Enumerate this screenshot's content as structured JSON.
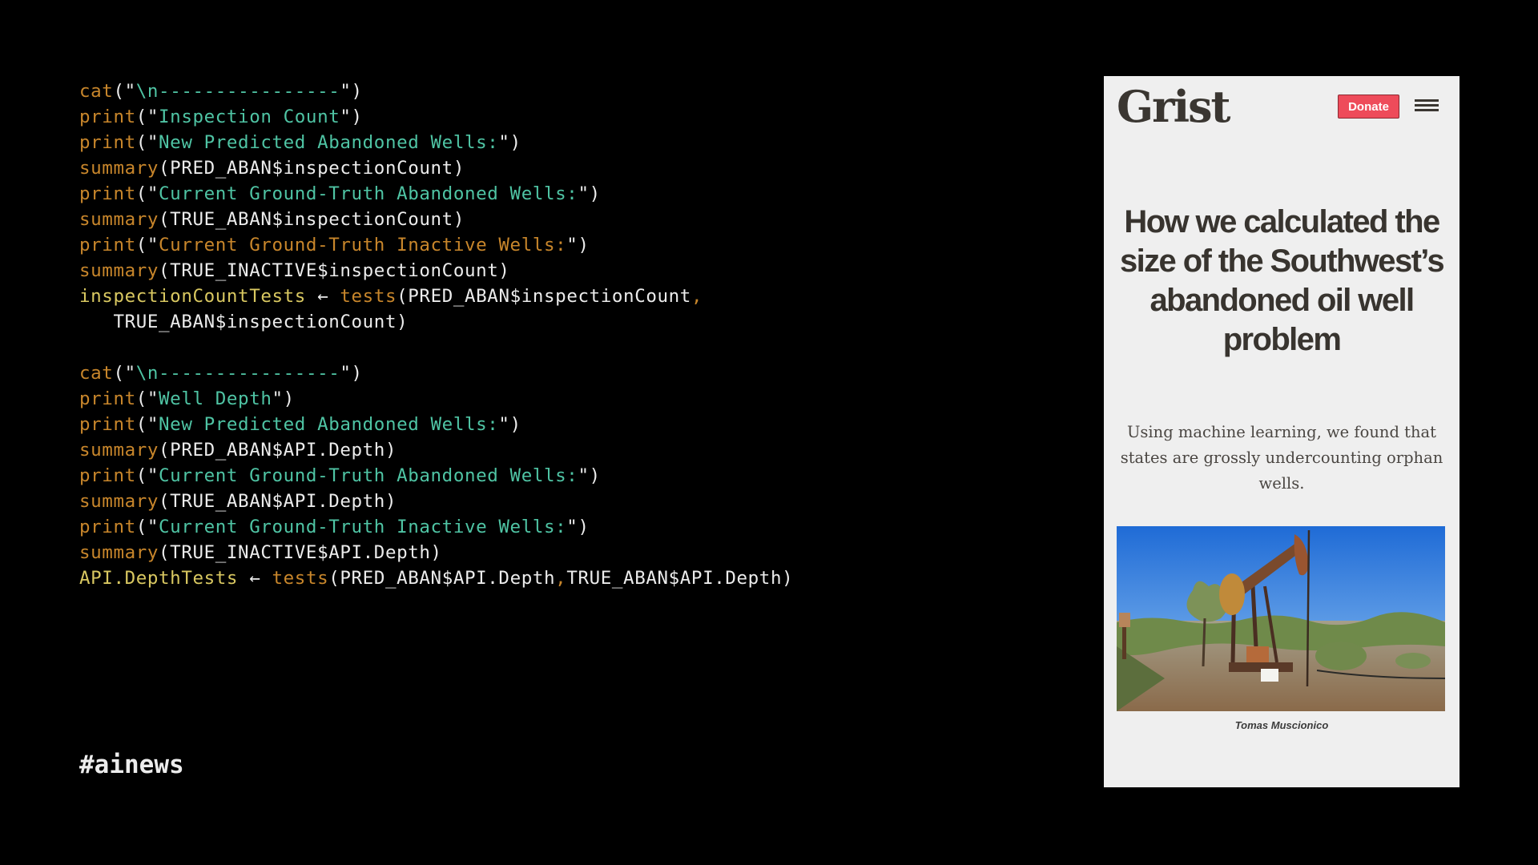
{
  "code": {
    "lines": [
      [
        {
          "t": "cat",
          "c": "fn"
        },
        {
          "t": "(\"",
          "c": "pl"
        },
        {
          "t": "\\n----------------",
          "c": "str"
        },
        {
          "t": "\")",
          "c": "pl"
        }
      ],
      [
        {
          "t": "print",
          "c": "fn"
        },
        {
          "t": "(\"",
          "c": "pl"
        },
        {
          "t": "Inspection Count",
          "c": "str"
        },
        {
          "t": "\")",
          "c": "pl"
        }
      ],
      [
        {
          "t": "print",
          "c": "fn"
        },
        {
          "t": "(\"",
          "c": "pl"
        },
        {
          "t": "New Predicted Abandoned Wells:",
          "c": "str"
        },
        {
          "t": "\")",
          "c": "pl"
        }
      ],
      [
        {
          "t": "summary",
          "c": "fn"
        },
        {
          "t": "(PRED_ABAN$inspectionCount)",
          "c": "pl"
        }
      ],
      [
        {
          "t": "print",
          "c": "fn"
        },
        {
          "t": "(\"",
          "c": "pl"
        },
        {
          "t": "Current Ground-Truth Abandoned Wells:",
          "c": "str"
        },
        {
          "t": "\")",
          "c": "pl"
        }
      ],
      [
        {
          "t": "summary",
          "c": "fn"
        },
        {
          "t": "(TRUE_ABAN$inspectionCount)",
          "c": "pl"
        }
      ],
      [
        {
          "t": "print",
          "c": "fn"
        },
        {
          "t": "(\"",
          "c": "pl"
        },
        {
          "t": "Current Ground-Truth Inactive Wells:",
          "c": "ostr"
        },
        {
          "t": "\")",
          "c": "pl"
        }
      ],
      [
        {
          "t": "summary",
          "c": "fn"
        },
        {
          "t": "(TRUE_INACTIVE$inspectionCount)",
          "c": "pl"
        }
      ],
      [
        {
          "t": "inspectionCountTests",
          "c": "var"
        },
        {
          "t": " ← ",
          "c": "pl"
        },
        {
          "t": "tests",
          "c": "fn"
        },
        {
          "t": "(PRED_ABAN$inspectionCount",
          "c": "pl"
        },
        {
          "t": ",",
          "c": "fn"
        }
      ],
      [
        {
          "t": "   TRUE_ABAN$inspectionCount)",
          "c": "pl"
        }
      ],
      [],
      [
        {
          "t": "cat",
          "c": "fn"
        },
        {
          "t": "(\"",
          "c": "pl"
        },
        {
          "t": "\\n----------------",
          "c": "str"
        },
        {
          "t": "\")",
          "c": "pl"
        }
      ],
      [
        {
          "t": "print",
          "c": "fn"
        },
        {
          "t": "(\"",
          "c": "pl"
        },
        {
          "t": "Well Depth",
          "c": "str"
        },
        {
          "t": "\")",
          "c": "pl"
        }
      ],
      [
        {
          "t": "print",
          "c": "fn"
        },
        {
          "t": "(\"",
          "c": "pl"
        },
        {
          "t": "New Predicted Abandoned Wells:",
          "c": "str"
        },
        {
          "t": "\")",
          "c": "pl"
        }
      ],
      [
        {
          "t": "summary",
          "c": "fn"
        },
        {
          "t": "(PRED_ABAN$API.Depth)",
          "c": "pl"
        }
      ],
      [
        {
          "t": "print",
          "c": "fn"
        },
        {
          "t": "(\"",
          "c": "pl"
        },
        {
          "t": "Current Ground-Truth Abandoned Wells:",
          "c": "str"
        },
        {
          "t": "\")",
          "c": "pl"
        }
      ],
      [
        {
          "t": "summary",
          "c": "fn"
        },
        {
          "t": "(TRUE_ABAN$API.Depth)",
          "c": "pl"
        }
      ],
      [
        {
          "t": "print",
          "c": "fn"
        },
        {
          "t": "(\"",
          "c": "pl"
        },
        {
          "t": "Current Ground-Truth Inactive Wells:",
          "c": "str"
        },
        {
          "t": "\")",
          "c": "pl"
        }
      ],
      [
        {
          "t": "summary",
          "c": "fn"
        },
        {
          "t": "(TRUE_INACTIVE$API.Depth)",
          "c": "pl"
        }
      ],
      [
        {
          "t": "API.DepthTests",
          "c": "var"
        },
        {
          "t": " ← ",
          "c": "pl"
        },
        {
          "t": "tests",
          "c": "fn"
        },
        {
          "t": "(PRED_ABAN$API.Depth",
          "c": "pl"
        },
        {
          "t": ",",
          "c": "fn"
        },
        {
          "t": "TRUE_ABAN$API.Depth)",
          "c": "pl"
        }
      ]
    ]
  },
  "hashtag": "#ainews",
  "article": {
    "logo": "Grist",
    "donate_label": "Donate",
    "menu_icon": "hamburger-menu-icon",
    "headline": "How we calculated the size of the Southwest’s abandoned oil well problem",
    "dek": "Using machine learning, we found that states are grossly undercounting orphan wells.",
    "photo_alt": "Rusted oil pumpjack in desert scrubland under blue sky",
    "caption": "Tomas Muscionico"
  },
  "colors": {
    "function": "#c8862b",
    "string": "#4fc4a4",
    "variable": "#d9c861",
    "plain": "#ececec",
    "donate": "#ee4b5a",
    "panel_bg": "#efefef"
  }
}
